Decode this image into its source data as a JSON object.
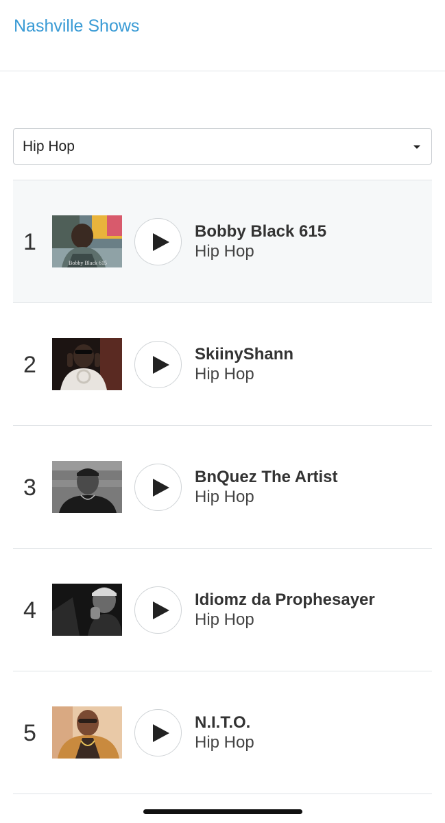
{
  "header": {
    "title": "Nashville Shows"
  },
  "genre_select": {
    "value": "Hip Hop"
  },
  "rows": [
    {
      "rank": "1",
      "artist": "Bobby Black 615",
      "genre": "Hip Hop",
      "thumb_caption": "Bobby Black 615"
    },
    {
      "rank": "2",
      "artist": "SkiinyShann",
      "genre": "Hip Hop"
    },
    {
      "rank": "3",
      "artist": "BnQuez The Artist",
      "genre": "Hip Hop"
    },
    {
      "rank": "4",
      "artist": "Idiomz da Prophesayer",
      "genre": "Hip Hop"
    },
    {
      "rank": "5",
      "artist": "N.I.T.O.",
      "genre": "Hip Hop"
    }
  ],
  "icons": {
    "play": "play-icon",
    "dropdown": "caret-down-icon"
  },
  "colors": {
    "link": "#3a9bd5",
    "active_row": "#f6f8f9",
    "divider": "#dfe3e6"
  }
}
